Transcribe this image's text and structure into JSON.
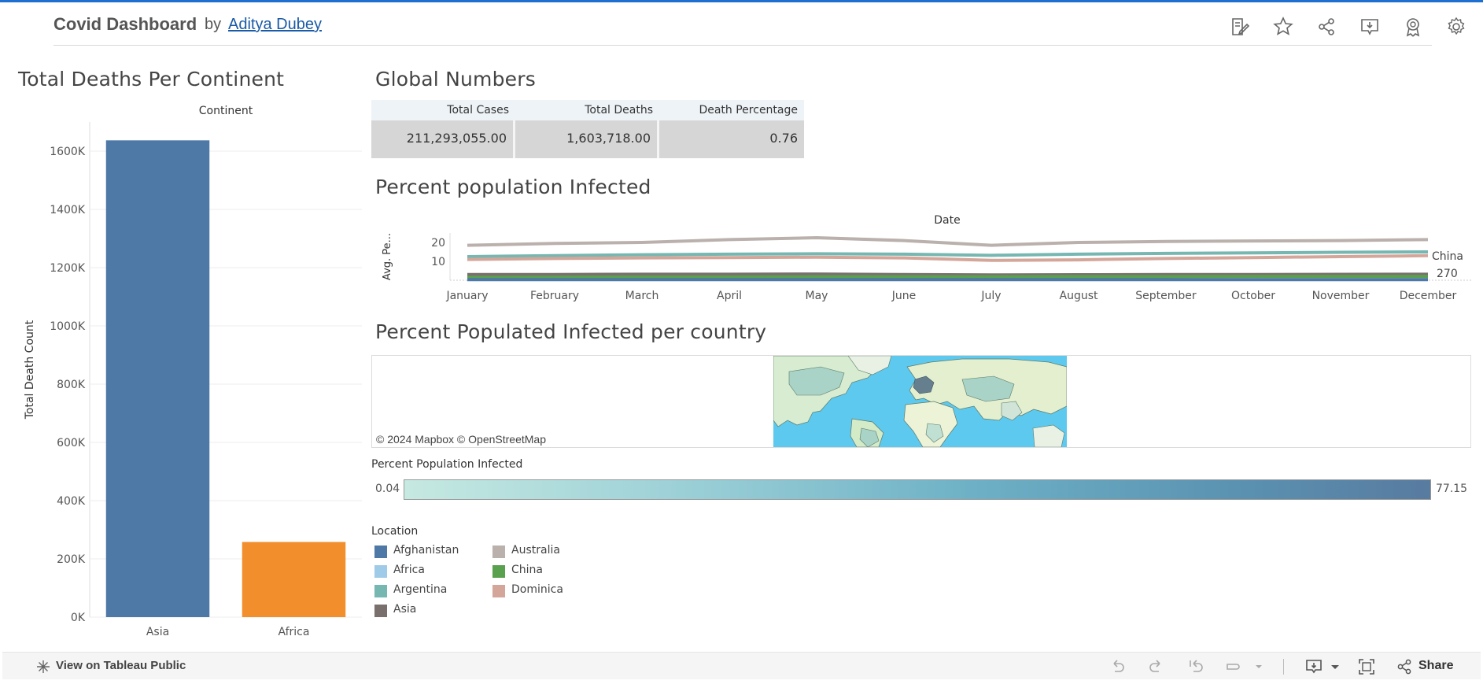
{
  "header": {
    "title": "Covid Dashboard",
    "by": "by",
    "author": "Aditya Dubey",
    "icons": [
      "edit-icon",
      "star-icon",
      "share-icon",
      "comment-icon",
      "award-icon",
      "gear-icon"
    ]
  },
  "bar_section": {
    "title": "Total Deaths Per Continent"
  },
  "global_section": {
    "title": "Global Numbers",
    "columns": [
      "Total Cases",
      "Total Deaths",
      "Death Percentage"
    ],
    "values": [
      "211,293,055.00",
      "1,603,718.00",
      "0.76"
    ]
  },
  "line_section": {
    "title": "Percent population Infected"
  },
  "map_section": {
    "title": "Percent Populated Infected per country",
    "credit": "© 2024 Mapbox  © OpenStreetMap",
    "legend_title": "Percent Population Infected",
    "legend_min": "0.04",
    "legend_max": "77.15"
  },
  "location_legend": {
    "title": "Location",
    "items": [
      {
        "label": "Afghanistan",
        "color": "#4e79a7"
      },
      {
        "label": "Africa",
        "color": "#a0cbe8"
      },
      {
        "label": "Argentina",
        "color": "#76b7b2"
      },
      {
        "label": "Asia",
        "color": "#79706e"
      },
      {
        "label": "Australia",
        "color": "#bab0ac"
      },
      {
        "label": "China",
        "color": "#59a14f"
      },
      {
        "label": "Dominica",
        "color": "#d4a69a"
      }
    ]
  },
  "footer": {
    "view_link": "View on Tableau Public",
    "share_label": "Share"
  },
  "chart_data": [
    {
      "type": "bar",
      "title": "",
      "header": "Continent",
      "categories": [
        "Asia",
        "Africa"
      ],
      "values": [
        1637000,
        258000
      ],
      "colors": [
        "#4e79a7",
        "#f28e2b"
      ],
      "ylabel": "Total Death Count",
      "xlabel": "",
      "ylim": [
        0,
        1700000
      ],
      "yticks": [
        0,
        200000,
        400000,
        600000,
        800000,
        1000000,
        1200000,
        1400000,
        1600000
      ],
      "ytick_labels": [
        "0K",
        "200K",
        "400K",
        "600K",
        "800K",
        "1000K",
        "1200K",
        "1400K",
        "1600K"
      ],
      "grid": true
    },
    {
      "type": "line",
      "title": "",
      "header": "Date",
      "x": [
        "January",
        "February",
        "March",
        "April",
        "May",
        "June",
        "July",
        "August",
        "September",
        "October",
        "November",
        "December"
      ],
      "ylabel": "Avg. Pe...",
      "ylim": [
        0,
        25
      ],
      "yticks": [
        10,
        20
      ],
      "series": [
        {
          "name": "Australia",
          "color": "#bab0ac",
          "values": [
            18.5,
            19.5,
            20.0,
            21.5,
            22.5,
            21.0,
            18.5,
            20.0,
            20.5,
            20.8,
            21.0,
            21.5
          ]
        },
        {
          "name": "Argentina",
          "color": "#76b7b2",
          "values": [
            12.5,
            13.0,
            13.5,
            13.8,
            14.0,
            13.8,
            13.2,
            13.8,
            14.2,
            14.5,
            14.8,
            15.0
          ]
        },
        {
          "name": "Dominica",
          "color": "#d4a69a",
          "values": [
            11.0,
            11.5,
            11.8,
            12.0,
            12.2,
            11.8,
            10.5,
            10.8,
            11.5,
            12.0,
            12.5,
            13.0
          ]
        },
        {
          "name": "Asia",
          "color": "#79706e",
          "values": [
            3.0,
            3.0,
            3.2,
            3.2,
            3.3,
            3.0,
            2.8,
            2.9,
            3.0,
            3.0,
            3.1,
            3.2
          ]
        },
        {
          "name": "China",
          "color": "#59a14f",
          "values": [
            1.5,
            1.6,
            1.7,
            1.7,
            1.8,
            1.8,
            1.8,
            1.9,
            1.9,
            2.0,
            2.0,
            2.0
          ]
        },
        {
          "name": "Afghanistan",
          "color": "#4e79a7",
          "values": [
            0.3,
            0.3,
            0.3,
            0.3,
            0.3,
            0.3,
            0.3,
            0.3,
            0.3,
            0.3,
            0.3,
            0.3
          ]
        }
      ],
      "end_labels": [
        "China",
        "270"
      ]
    }
  ]
}
